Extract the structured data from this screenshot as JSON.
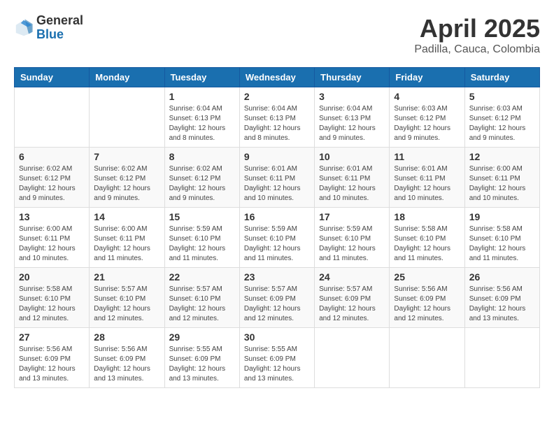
{
  "header": {
    "logo_general": "General",
    "logo_blue": "Blue",
    "month_title": "April 2025",
    "location": "Padilla, Cauca, Colombia"
  },
  "weekdays": [
    "Sunday",
    "Monday",
    "Tuesday",
    "Wednesday",
    "Thursday",
    "Friday",
    "Saturday"
  ],
  "weeks": [
    [
      {
        "day": "",
        "info": ""
      },
      {
        "day": "",
        "info": ""
      },
      {
        "day": "1",
        "info": "Sunrise: 6:04 AM\nSunset: 6:13 PM\nDaylight: 12 hours and 8 minutes."
      },
      {
        "day": "2",
        "info": "Sunrise: 6:04 AM\nSunset: 6:13 PM\nDaylight: 12 hours and 8 minutes."
      },
      {
        "day": "3",
        "info": "Sunrise: 6:04 AM\nSunset: 6:13 PM\nDaylight: 12 hours and 9 minutes."
      },
      {
        "day": "4",
        "info": "Sunrise: 6:03 AM\nSunset: 6:12 PM\nDaylight: 12 hours and 9 minutes."
      },
      {
        "day": "5",
        "info": "Sunrise: 6:03 AM\nSunset: 6:12 PM\nDaylight: 12 hours and 9 minutes."
      }
    ],
    [
      {
        "day": "6",
        "info": "Sunrise: 6:02 AM\nSunset: 6:12 PM\nDaylight: 12 hours and 9 minutes."
      },
      {
        "day": "7",
        "info": "Sunrise: 6:02 AM\nSunset: 6:12 PM\nDaylight: 12 hours and 9 minutes."
      },
      {
        "day": "8",
        "info": "Sunrise: 6:02 AM\nSunset: 6:12 PM\nDaylight: 12 hours and 9 minutes."
      },
      {
        "day": "9",
        "info": "Sunrise: 6:01 AM\nSunset: 6:11 PM\nDaylight: 12 hours and 10 minutes."
      },
      {
        "day": "10",
        "info": "Sunrise: 6:01 AM\nSunset: 6:11 PM\nDaylight: 12 hours and 10 minutes."
      },
      {
        "day": "11",
        "info": "Sunrise: 6:01 AM\nSunset: 6:11 PM\nDaylight: 12 hours and 10 minutes."
      },
      {
        "day": "12",
        "info": "Sunrise: 6:00 AM\nSunset: 6:11 PM\nDaylight: 12 hours and 10 minutes."
      }
    ],
    [
      {
        "day": "13",
        "info": "Sunrise: 6:00 AM\nSunset: 6:11 PM\nDaylight: 12 hours and 10 minutes."
      },
      {
        "day": "14",
        "info": "Sunrise: 6:00 AM\nSunset: 6:11 PM\nDaylight: 12 hours and 11 minutes."
      },
      {
        "day": "15",
        "info": "Sunrise: 5:59 AM\nSunset: 6:10 PM\nDaylight: 12 hours and 11 minutes."
      },
      {
        "day": "16",
        "info": "Sunrise: 5:59 AM\nSunset: 6:10 PM\nDaylight: 12 hours and 11 minutes."
      },
      {
        "day": "17",
        "info": "Sunrise: 5:59 AM\nSunset: 6:10 PM\nDaylight: 12 hours and 11 minutes."
      },
      {
        "day": "18",
        "info": "Sunrise: 5:58 AM\nSunset: 6:10 PM\nDaylight: 12 hours and 11 minutes."
      },
      {
        "day": "19",
        "info": "Sunrise: 5:58 AM\nSunset: 6:10 PM\nDaylight: 12 hours and 11 minutes."
      }
    ],
    [
      {
        "day": "20",
        "info": "Sunrise: 5:58 AM\nSunset: 6:10 PM\nDaylight: 12 hours and 12 minutes."
      },
      {
        "day": "21",
        "info": "Sunrise: 5:57 AM\nSunset: 6:10 PM\nDaylight: 12 hours and 12 minutes."
      },
      {
        "day": "22",
        "info": "Sunrise: 5:57 AM\nSunset: 6:10 PM\nDaylight: 12 hours and 12 minutes."
      },
      {
        "day": "23",
        "info": "Sunrise: 5:57 AM\nSunset: 6:09 PM\nDaylight: 12 hours and 12 minutes."
      },
      {
        "day": "24",
        "info": "Sunrise: 5:57 AM\nSunset: 6:09 PM\nDaylight: 12 hours and 12 minutes."
      },
      {
        "day": "25",
        "info": "Sunrise: 5:56 AM\nSunset: 6:09 PM\nDaylight: 12 hours and 12 minutes."
      },
      {
        "day": "26",
        "info": "Sunrise: 5:56 AM\nSunset: 6:09 PM\nDaylight: 12 hours and 13 minutes."
      }
    ],
    [
      {
        "day": "27",
        "info": "Sunrise: 5:56 AM\nSunset: 6:09 PM\nDaylight: 12 hours and 13 minutes."
      },
      {
        "day": "28",
        "info": "Sunrise: 5:56 AM\nSunset: 6:09 PM\nDaylight: 12 hours and 13 minutes."
      },
      {
        "day": "29",
        "info": "Sunrise: 5:55 AM\nSunset: 6:09 PM\nDaylight: 12 hours and 13 minutes."
      },
      {
        "day": "30",
        "info": "Sunrise: 5:55 AM\nSunset: 6:09 PM\nDaylight: 12 hours and 13 minutes."
      },
      {
        "day": "",
        "info": ""
      },
      {
        "day": "",
        "info": ""
      },
      {
        "day": "",
        "info": ""
      }
    ]
  ]
}
